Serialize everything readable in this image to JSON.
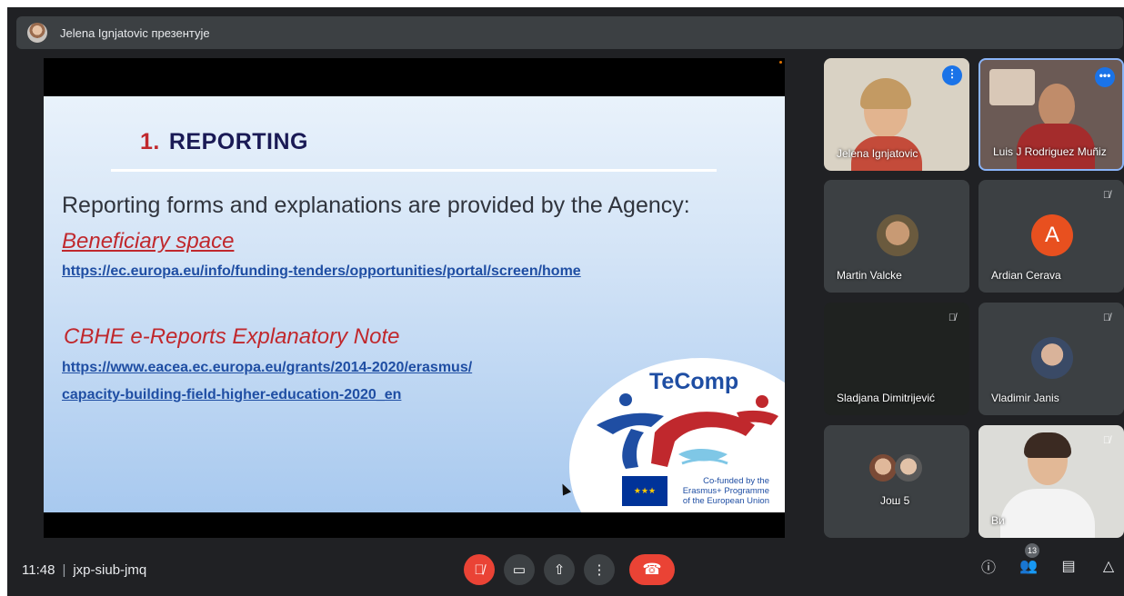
{
  "presenter": {
    "text": "Jelena Ignjatovic презентује"
  },
  "slide": {
    "title_num": "1.",
    "title": "REPORTING",
    "intro": "Reporting forms and explanations are provided by the Agency:",
    "beneficiary": "Beneficiary space",
    "link1": "https://ec.europa.eu/info/funding-tenders/opportunities/portal/screen/home",
    "cbhe": "CBHE e-Reports Explanatory Note",
    "link2": "https://www.eacea.ec.europa.eu/grants/2014-2020/erasmus/",
    "link3": "capacity-building-field-higher-education-2020_en",
    "logo_name": "TeComp",
    "cofund_line1": "Co-funded by the",
    "cofund_line2": "Erasmus+ Programme",
    "cofund_line3": "of the European Union"
  },
  "participants": [
    {
      "name": "Jelena Ignjatovic"
    },
    {
      "name": "Luis J Rodriguez Muñiz"
    },
    {
      "name": "Martin Valcke"
    },
    {
      "name": "Ardian Cerava",
      "initial": "A"
    },
    {
      "name": "Sladjana Dimitrijević"
    },
    {
      "name": "Vladimir Janis"
    },
    {
      "name": "Још 5"
    },
    {
      "name": "Ви"
    }
  ],
  "bottom": {
    "time": "11:48",
    "meeting_code": "jxp-siub-jmq",
    "people_count": "13"
  },
  "colors": {
    "mic_off_red": "#ea4335",
    "background": "#202124",
    "accent_blue": "#1a73e8"
  }
}
